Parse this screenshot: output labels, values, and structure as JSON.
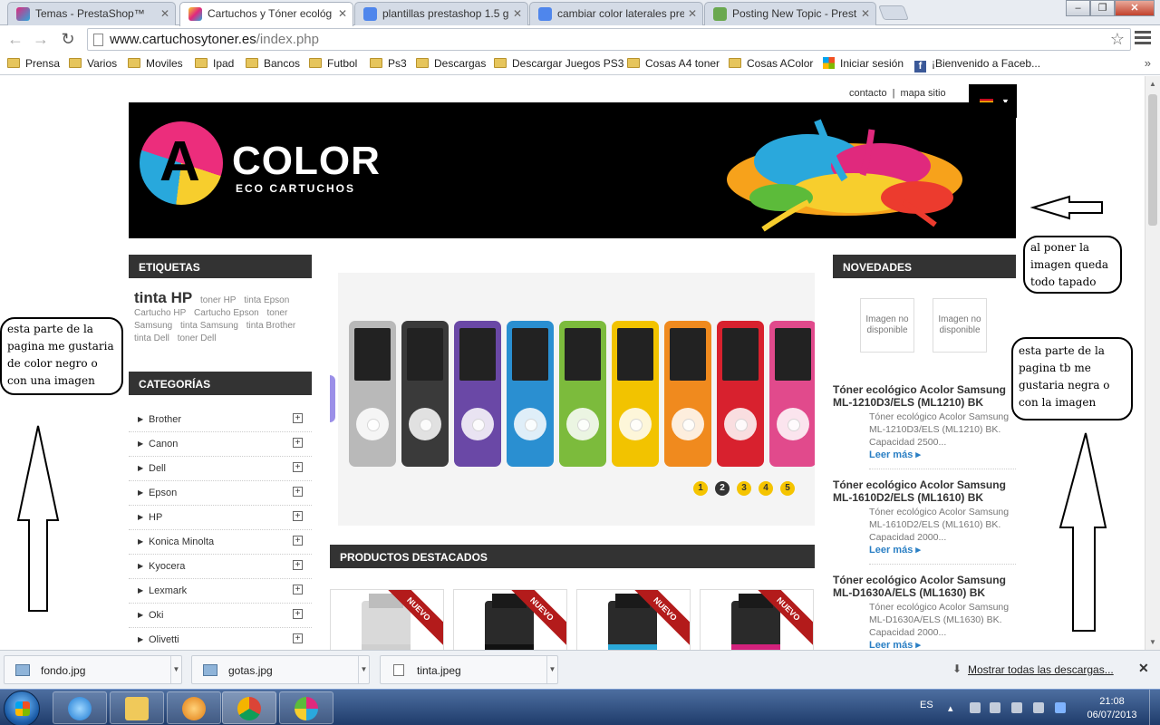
{
  "browser": {
    "tabs": [
      {
        "label": "Temas - PrestaShop™",
        "active": false,
        "icon": "prestashop-icon"
      },
      {
        "label": "Cartuchos y Tóner ecológ",
        "active": true,
        "icon": "prestashop-icon"
      },
      {
        "label": "plantillas prestashop 1.5 g",
        "active": false,
        "icon": "google-icon"
      },
      {
        "label": "cambiar color laterales pre",
        "active": false,
        "icon": "google-icon"
      },
      {
        "label": "Posting New Topic - Prest",
        "active": false,
        "icon": "forum-icon"
      }
    ],
    "url_host": "www.cartuchosytoner.es",
    "url_path": "/index.php",
    "bookmarks": [
      {
        "label": "Prensa",
        "type": "folder"
      },
      {
        "label": "Varios",
        "type": "folder"
      },
      {
        "label": "Moviles",
        "type": "folder"
      },
      {
        "label": "Ipad",
        "type": "folder"
      },
      {
        "label": "Bancos",
        "type": "folder"
      },
      {
        "label": "Futbol",
        "type": "folder"
      },
      {
        "label": "Ps3",
        "type": "folder"
      },
      {
        "label": "Descargas",
        "type": "folder"
      },
      {
        "label": "Descargar Juegos PS3",
        "type": "folder"
      },
      {
        "label": "Cosas A4 toner",
        "type": "folder"
      },
      {
        "label": "Cosas AColor",
        "type": "folder"
      },
      {
        "label": "Iniciar sesión",
        "type": "microsoft"
      },
      {
        "label": "¡Bienvenido a Faceb...",
        "type": "facebook"
      }
    ],
    "bookmarks_more": "»"
  },
  "site": {
    "toplinks": {
      "contact": "contacto",
      "sep": "|",
      "sitemap": "mapa sitio"
    },
    "logo": {
      "letter": "A",
      "name": "COLOR",
      "sub": "ECO CARTUCHOS"
    },
    "tags_block": {
      "title": "ETIQUETAS",
      "big_tag": "tinta HP",
      "tags": [
        "toner HP",
        "tinta Epson",
        "Cartucho HP",
        "Cartucho Epson",
        "toner Samsung",
        "tinta Samsung",
        "tinta Brother",
        "tinta Dell",
        "toner Dell"
      ]
    },
    "categories_block": {
      "title": "CATEGORÍAS",
      "items": [
        "Brother",
        "Canon",
        "Dell",
        "Epson",
        "HP",
        "Konica Minolta",
        "Kyocera",
        "Lexmark",
        "Oki",
        "Olivetti"
      ]
    },
    "slider": {
      "pages": [
        "1",
        "2",
        "3",
        "4",
        "5"
      ],
      "current": 2,
      "ipod_colors": [
        "#b9b9b9",
        "#3a3a3a",
        "#6a48a6",
        "#2a8fd1",
        "#7cbb3c",
        "#f2c300",
        "#f08a1e",
        "#d8212e",
        "#e14a8c"
      ]
    },
    "featured_title": "PRODUCTOS DESTACADOS",
    "new_badge": "NUEVO",
    "featured_colors": [
      "#cfcfcf",
      "#111111",
      "#2aa8d8",
      "#d3217c"
    ],
    "novedades": {
      "title": "NOVEDADES",
      "noimage": "Imagen no disponible",
      "items": [
        {
          "title": "Tóner ecológico Acolor Samsung ML-1210D3/ELS (ML1210) BK",
          "desc": "Tóner ecológico Acolor Samsung ML-1210D3/ELS (ML1210) BK. Capacidad 2500...",
          "more": "Leer más"
        },
        {
          "title": "Tóner ecológico Acolor Samsung ML-1610D2/ELS (ML1610) BK",
          "desc": "Tóner ecológico Acolor Samsung ML-1610D2/ELS (ML1610) BK. Capacidad 2000...",
          "more": "Leer más"
        },
        {
          "title": "Tóner ecológico Acolor Samsung ML-D1630A/ELS (ML1630) BK",
          "desc": "Tóner ecológico Acolor Samsung ML-D1630A/ELS (ML1630) BK. Capacidad 2000...",
          "more": "Leer más"
        }
      ]
    }
  },
  "annotations": {
    "left": "esta parte de la pagina me gustaria de color negro o con una  imagen",
    "right": "esta parte de la pagina tb me gustaria negra o con la imagen",
    "banner": "al poner la imagen queda todo tapado"
  },
  "downloads": {
    "items": [
      "fondo.jpg",
      "gotas.jpg",
      "tinta.jpeg"
    ],
    "show_all": "Mostrar todas las descargas...",
    "close": "✕"
  },
  "taskbar": {
    "lang": "ES",
    "time": "21:08",
    "date": "06/07/2013"
  }
}
